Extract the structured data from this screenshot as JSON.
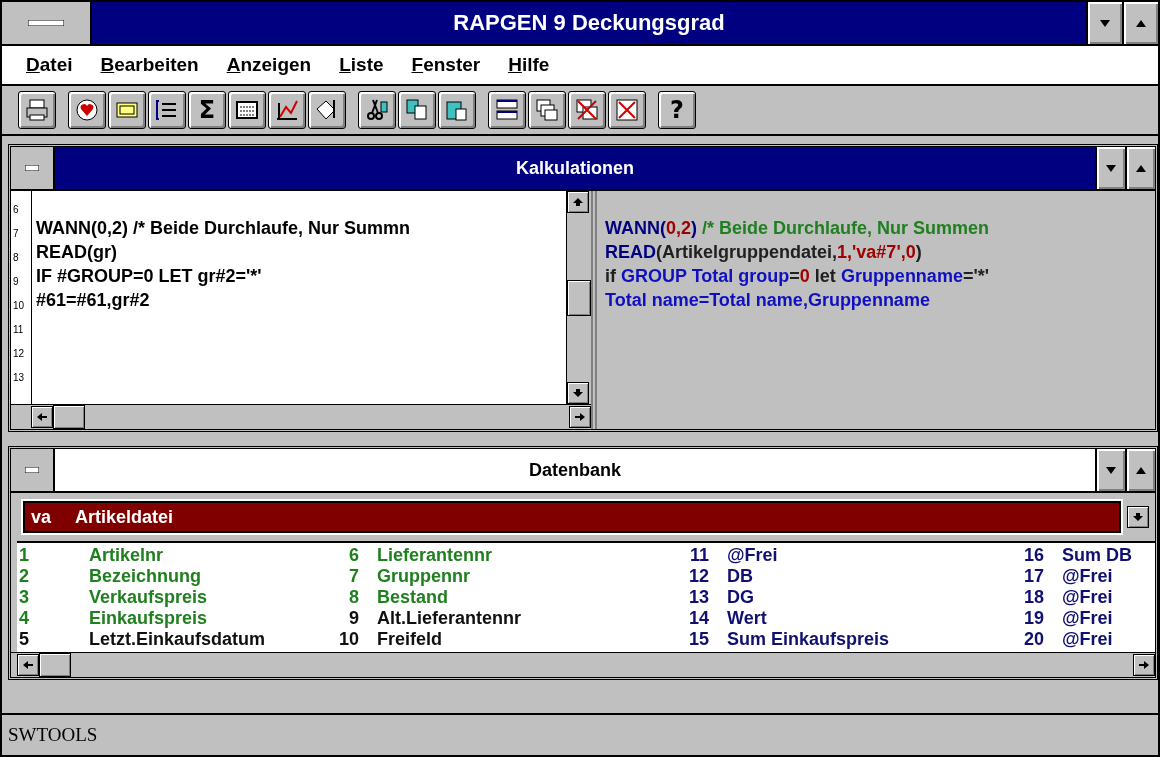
{
  "window": {
    "title": "RAPGEN 9 Deckungsgrad"
  },
  "menu": [
    "Datei",
    "Bearbeiten",
    "Anzeigen",
    "Liste",
    "Fenster",
    "Hilfe"
  ],
  "toolbar": {
    "groups": [
      {
        "buttons": [
          {
            "kind": "icon"
          }
        ]
      },
      {
        "buttons": [
          {
            "kind": "icon"
          },
          {
            "kind": "icon"
          },
          {
            "kind": "icon"
          },
          {
            "kind": "text",
            "label": "Σ"
          },
          {
            "kind": "icon"
          },
          {
            "kind": "icon"
          },
          {
            "kind": "icon"
          }
        ]
      },
      {
        "buttons": [
          {
            "kind": "icon"
          },
          {
            "kind": "icon"
          },
          {
            "kind": "icon"
          }
        ]
      },
      {
        "buttons": [
          {
            "kind": "icon"
          },
          {
            "kind": "icon"
          },
          {
            "kind": "icon"
          },
          {
            "kind": "icon"
          }
        ]
      },
      {
        "buttons": [
          {
            "kind": "text",
            "label": "?"
          }
        ]
      }
    ]
  },
  "calc_window": {
    "title": "Kalkulationen",
    "active": true,
    "editor": {
      "lines": [
        {
          "number": "6"
        },
        {
          "number": "7",
          "text": "WANN(0,2) /* Beide Durchlaufe, Nur Summn"
        },
        {
          "number": "8",
          "text": "READ(gr)"
        },
        {
          "number": "9",
          "text": "IF #GROUP=0 LET gr#2='*'"
        },
        {
          "number": "10",
          "text": "#61=#61,gr#2"
        },
        {
          "number": "11"
        },
        {
          "number": "12"
        },
        {
          "number": "13"
        }
      ]
    },
    "preview": {
      "lines": [
        {
          "segments": [
            {
              "text": "WANN(",
              "color": "#000080"
            },
            {
              "text": "0,2",
              "color": "#a00000"
            },
            {
              "text": ") ",
              "color": "#000080"
            },
            {
              "text": "/* Beide Durchlaufe, Nur Summen",
              "color": "#208020"
            }
          ]
        },
        {
          "segments": [
            {
              "text": "READ",
              "color": "#000080"
            },
            {
              "text": "(Artikelgruppendatei,",
              "color": "#202020"
            },
            {
              "text": "1,'va#7',0",
              "color": "#a00000"
            },
            {
              "text": ")",
              "color": "#202020"
            }
          ]
        },
        {
          "segments": [
            {
              "text": "if ",
              "color": "#202020"
            },
            {
              "text": "GROUP Total group",
              "color": "#1010c0"
            },
            {
              "text": "=",
              "color": "#202020"
            },
            {
              "text": "0",
              "color": "#a00000"
            },
            {
              "text": " let ",
              "color": "#202020"
            },
            {
              "text": "Gruppenname",
              "color": "#1010c0"
            },
            {
              "text": "='*'",
              "color": "#202020"
            }
          ]
        },
        {
          "segments": [
            {
              "text": "Total name=Total name,Gruppenname",
              "color": "#1010c0"
            }
          ]
        }
      ]
    }
  },
  "db_window": {
    "title": "Datenbank",
    "active": false,
    "database_select": {
      "code": "va",
      "value": "Artikeldatei"
    },
    "fields": [
      {
        "number": "1",
        "name": "Artikelnr",
        "color": "#208020"
      },
      {
        "number": "2",
        "name": "Bezeichnung",
        "color": "#208020"
      },
      {
        "number": "3",
        "name": "Verkaufspreis",
        "color": "#208020"
      },
      {
        "number": "4",
        "name": "Einkaufspreis",
        "color": "#208020"
      },
      {
        "number": "5",
        "name": "Letzt.Einkaufsdatum",
        "color": "#101010"
      },
      {
        "number": "6",
        "name": "Lieferantennr",
        "color": "#208020"
      },
      {
        "number": "7",
        "name": "Gruppennr",
        "color": "#208020"
      },
      {
        "number": "8",
        "name": "Bestand",
        "color": "#208020"
      },
      {
        "number": "9",
        "name": "Alt.Lieferantennr",
        "color": "#101010"
      },
      {
        "number": "10",
        "name": "Freifeld",
        "color": "#101010"
      },
      {
        "number": "11",
        "name": "@Frei",
        "color": "#101070"
      },
      {
        "number": "12",
        "name": "DB",
        "color": "#101070"
      },
      {
        "number": "13",
        "name": "DG",
        "color": "#101070"
      },
      {
        "number": "14",
        "name": "Wert",
        "color": "#101070"
      },
      {
        "number": "15",
        "name": "Sum Einkaufspreis",
        "color": "#101070"
      },
      {
        "number": "16",
        "name": "Sum DB",
        "color": "#101070"
      },
      {
        "number": "17",
        "name": "@Frei",
        "color": "#101070"
      },
      {
        "number": "18",
        "name": "@Frei",
        "color": "#101070"
      },
      {
        "number": "19",
        "name": "@Frei",
        "color": "#101070"
      },
      {
        "number": "20",
        "name": "@Frei",
        "color": "#101070"
      }
    ]
  },
  "status_bar": {
    "text": "SWTOOLS"
  }
}
